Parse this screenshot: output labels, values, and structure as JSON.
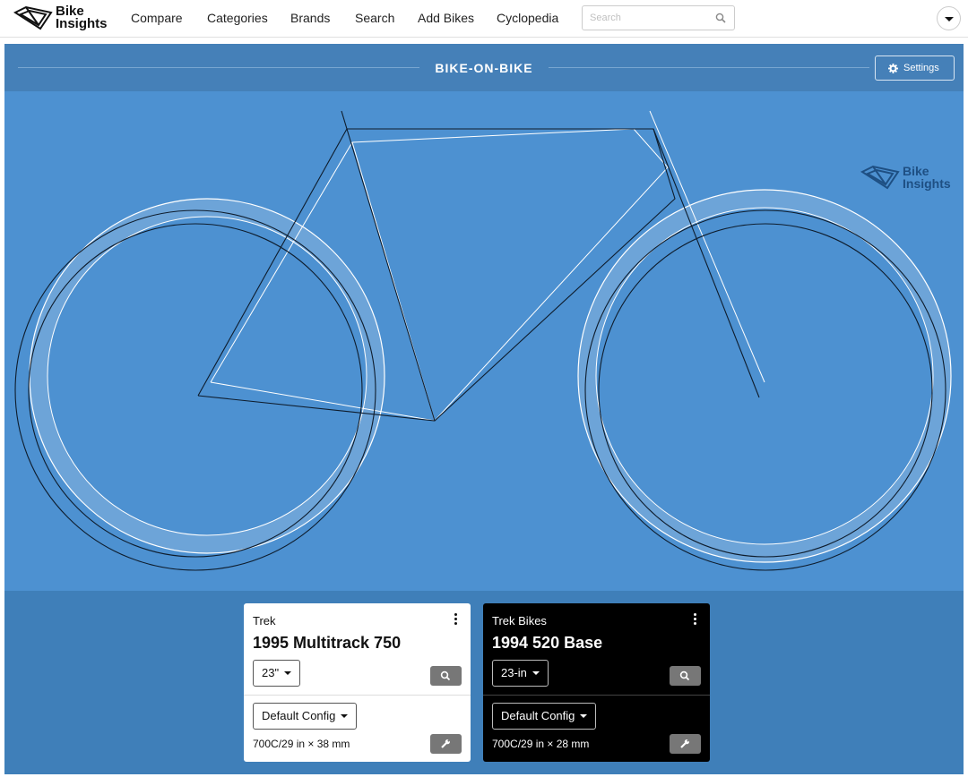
{
  "brand_logo": {
    "line1": "Bike",
    "line2": "Insights"
  },
  "nav": {
    "items": [
      "Compare",
      "Categories",
      "Brands",
      "Search",
      "Add Bikes",
      "Cyclopedia"
    ],
    "search_placeholder": "Search",
    "search_icon": "search-icon",
    "user_menu_icon": "caret-down-icon"
  },
  "panel": {
    "title": "BIKE-ON-BIKE",
    "settings_label": "Settings",
    "settings_icon": "gear-icon",
    "watermark": {
      "line1": "Bike",
      "line2": "Insights"
    }
  },
  "colors": {
    "canvas_bg": "#4d91d1",
    "panel_bg": "#3f7fb9",
    "bike_a_stroke": "#ffffff",
    "bike_b_stroke": "#0e1c2c",
    "tire_fill": "#a9c8e6"
  },
  "bikes": [
    {
      "brand": "Trek",
      "model": "1995 Multitrack 750",
      "size": "23\"",
      "config": "Default Config",
      "tire": "700C/29 in × 38 mm",
      "theme": "white"
    },
    {
      "brand": "Trek Bikes",
      "model": "1994 520 Base",
      "size": "23-in",
      "config": "Default Config",
      "tire": "700C/29 in × 28 mm",
      "theme": "black"
    }
  ]
}
